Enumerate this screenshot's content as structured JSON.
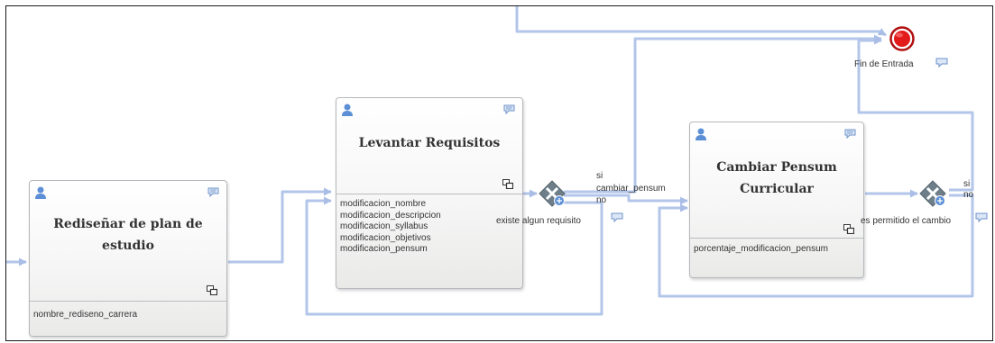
{
  "tasks": {
    "redisenar": {
      "title_line1": "Rediseñar de plan de",
      "title_line2": "estudio",
      "fields": [
        "nombre_rediseno_carrera"
      ]
    },
    "levantar": {
      "title": "Levantar Requisitos",
      "fields": [
        "modificacion_nombre",
        "modificacion_descripcion",
        "modificacion_syllabus",
        "modificacion_objetivos",
        "modificacion_pensum"
      ]
    },
    "cambiar": {
      "title_line1": "Cambiar  Pensum",
      "title_line2": "Curricular",
      "fields": [
        "porcentaje_modificacion_pensum"
      ]
    }
  },
  "gateways": {
    "requisito": {
      "label": "existe algun requisito",
      "out_si": "si",
      "out_cambiar": "cambiar_pensum",
      "out_no": "no"
    },
    "permitido": {
      "label": "es permitido el cambio",
      "out_si": "si",
      "out_no": "no"
    }
  },
  "end_event": {
    "label": "Fin de Entrada"
  },
  "colors": {
    "connector": "#b3c6ea",
    "user_icon": "#5c8fd6",
    "end_fill": "#e21a1a",
    "gateway": "#6e7f8a"
  },
  "icons": [
    "user-icon",
    "comment-icon",
    "subprocess-icon",
    "gateway-icon",
    "end-event-icon"
  ]
}
